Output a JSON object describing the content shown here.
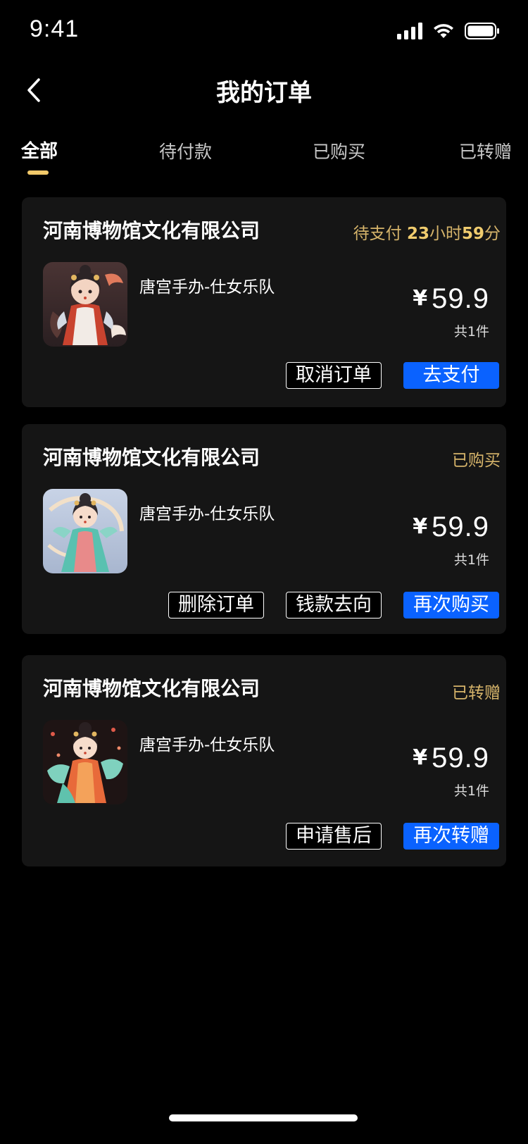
{
  "status_bar": {
    "time": "9:41",
    "icons": [
      "signal-icon",
      "wifi-icon",
      "battery-icon"
    ]
  },
  "nav": {
    "title": "我的订单",
    "back_icon": "chevron-left-icon"
  },
  "tabs": [
    {
      "label": "全部",
      "active": true
    },
    {
      "label": "待付款",
      "active": false
    },
    {
      "label": "已购买",
      "active": false
    },
    {
      "label": "已转赠",
      "active": false
    }
  ],
  "orders": [
    {
      "shop": "河南博物馆文化有限公司",
      "status_prefix": "待支付 ",
      "status_hours": "23",
      "status_hours_unit": "小时",
      "status_minutes": "59",
      "status_minutes_unit": "分",
      "product": "唐宫手办-仕女乐队",
      "currency": "¥",
      "price": "59.9",
      "quantity": "共1件",
      "buttons": [
        "取消订单",
        "去支付"
      ]
    },
    {
      "shop": "河南博物馆文化有限公司",
      "status": "已购买",
      "product": "唐宫手办-仕女乐队",
      "currency": "¥",
      "price": "59.9",
      "quantity": "共1件",
      "buttons": [
        "删除订单",
        "钱款去向",
        "再次购买"
      ]
    },
    {
      "shop": "河南博物馆文化有限公司",
      "status": "已转赠",
      "product": "唐宫手办-仕女乐队",
      "currency": "¥",
      "price": "59.9",
      "quantity": "共1件",
      "buttons": [
        "申请售后",
        "再次转赠"
      ]
    }
  ],
  "colors": {
    "background": "#000000",
    "card": "#151515",
    "accent_gold": "#d6b46a",
    "primary_blue": "#0a62ff",
    "tab_indicator": "#f2c96a"
  }
}
